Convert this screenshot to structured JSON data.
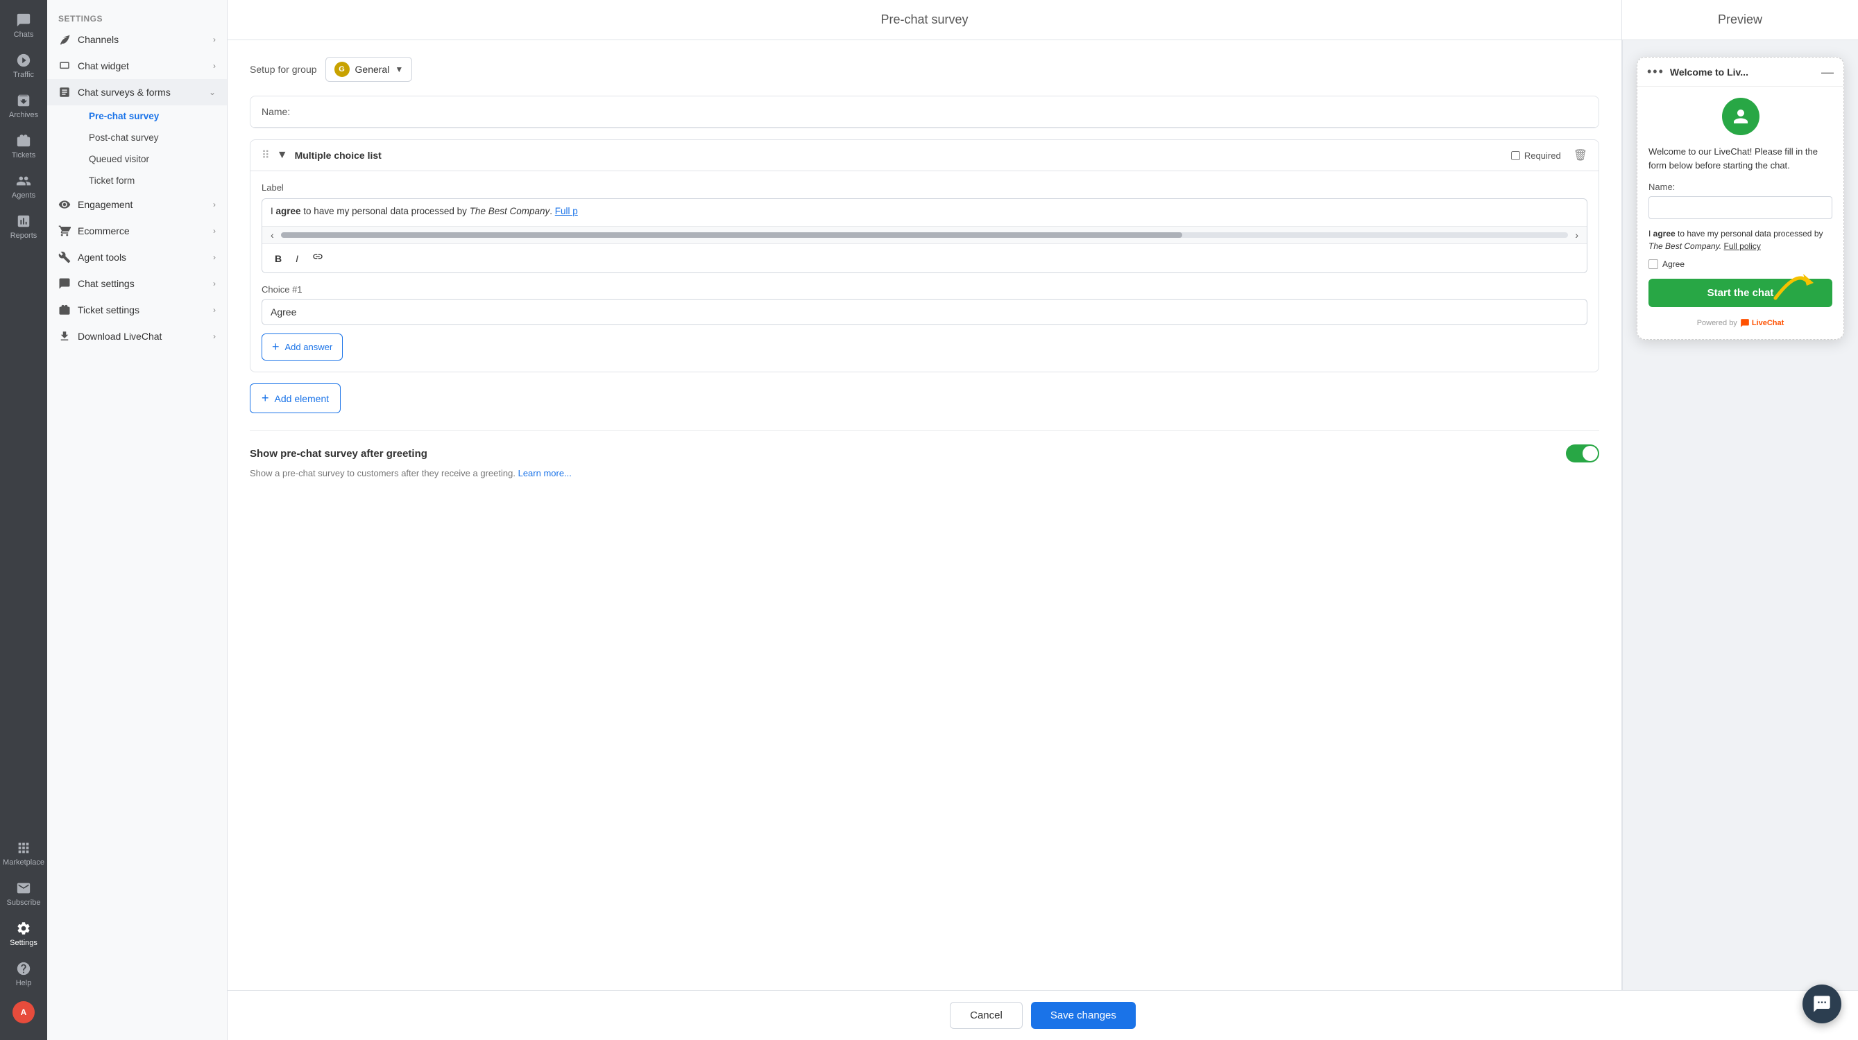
{
  "app": {
    "title": "Settings"
  },
  "left_nav": {
    "items": [
      {
        "id": "chats",
        "label": "Chats",
        "icon": "chat"
      },
      {
        "id": "traffic",
        "label": "Traffic",
        "icon": "traffic"
      },
      {
        "id": "archives",
        "label": "Archives",
        "icon": "archives"
      },
      {
        "id": "tickets",
        "label": "Tickets",
        "icon": "tickets"
      },
      {
        "id": "agents",
        "label": "Agents",
        "icon": "agents"
      },
      {
        "id": "reports",
        "label": "Reports",
        "icon": "reports"
      },
      {
        "id": "marketplace",
        "label": "Marketplace",
        "icon": "marketplace"
      },
      {
        "id": "subscribe",
        "label": "Subscribe",
        "icon": "subscribe"
      },
      {
        "id": "settings",
        "label": "Settings",
        "icon": "settings",
        "active": true
      }
    ],
    "bottom_items": [
      {
        "id": "help",
        "label": "Help",
        "icon": "help"
      },
      {
        "id": "avatar",
        "label": "",
        "icon": "avatar"
      }
    ]
  },
  "sidebar": {
    "sections": [
      {
        "id": "channels",
        "label": "Channels",
        "icon": "channels",
        "expanded": false
      },
      {
        "id": "chat-widget",
        "label": "Chat widget",
        "icon": "chat-widget",
        "expanded": false
      },
      {
        "id": "chat-surveys",
        "label": "Chat surveys & forms",
        "icon": "surveys",
        "expanded": true,
        "sub_items": [
          {
            "id": "pre-chat",
            "label": "Pre-chat survey",
            "active": true
          },
          {
            "id": "post-chat",
            "label": "Post-chat survey"
          },
          {
            "id": "queued-visitor",
            "label": "Queued visitor"
          },
          {
            "id": "ticket-form",
            "label": "Ticket form"
          }
        ]
      },
      {
        "id": "engagement",
        "label": "Engagement",
        "icon": "engagement",
        "expanded": false
      },
      {
        "id": "ecommerce",
        "label": "Ecommerce",
        "icon": "ecommerce",
        "expanded": false
      },
      {
        "id": "agent-tools",
        "label": "Agent tools",
        "icon": "agent-tools",
        "expanded": false
      },
      {
        "id": "chat-settings",
        "label": "Chat settings",
        "icon": "chat-settings",
        "expanded": false
      },
      {
        "id": "ticket-settings",
        "label": "Ticket settings",
        "icon": "ticket-settings",
        "expanded": false
      },
      {
        "id": "download",
        "label": "Download LiveChat",
        "icon": "download",
        "expanded": false
      }
    ]
  },
  "header": {
    "settings_title": "Settings",
    "main_title": "Pre-chat survey",
    "preview_title": "Preview"
  },
  "group_selector": {
    "label": "Setup for group",
    "badge_letter": "G",
    "group_name": "General"
  },
  "name_field": {
    "label": "Name:"
  },
  "multiple_choice": {
    "title": "Multiple choice list",
    "required_label": "Required",
    "label_text": "Label",
    "content_text": "I agree to have my personal data processed by The Best Company. Full p",
    "content_bold": "agree",
    "content_company": "The Best Company",
    "content_link": "Full policy",
    "choice_label": "Choice #1",
    "choice_value": "Agree",
    "add_answer_label": "Add answer",
    "toolbar": {
      "bold": "B",
      "italic": "I",
      "link": "🔗"
    }
  },
  "add_element": {
    "label": "Add element"
  },
  "survey_toggle": {
    "title": "Show pre-chat survey after greeting",
    "description": "Show a pre-chat survey to customers after they receive a greeting.",
    "learn_more": "Learn more...",
    "enabled": true
  },
  "footer": {
    "cancel_label": "Cancel",
    "save_label": "Save changes"
  },
  "preview": {
    "widget_title": "Welcome to Liv...",
    "greeting_text": "Welcome to our LiveChat! Please fill in the form below before starting the chat.",
    "name_label": "Name:",
    "consent_text_1": "I ",
    "consent_bold": "agree",
    "consent_text_2": " to have my personal data processed by ",
    "consent_company": "The Best Company.",
    "consent_link": "Full policy",
    "checkbox_label": "Agree",
    "start_button": "Start the chat",
    "powered_by": "Powered by",
    "livechat_brand": "LiveChat"
  }
}
